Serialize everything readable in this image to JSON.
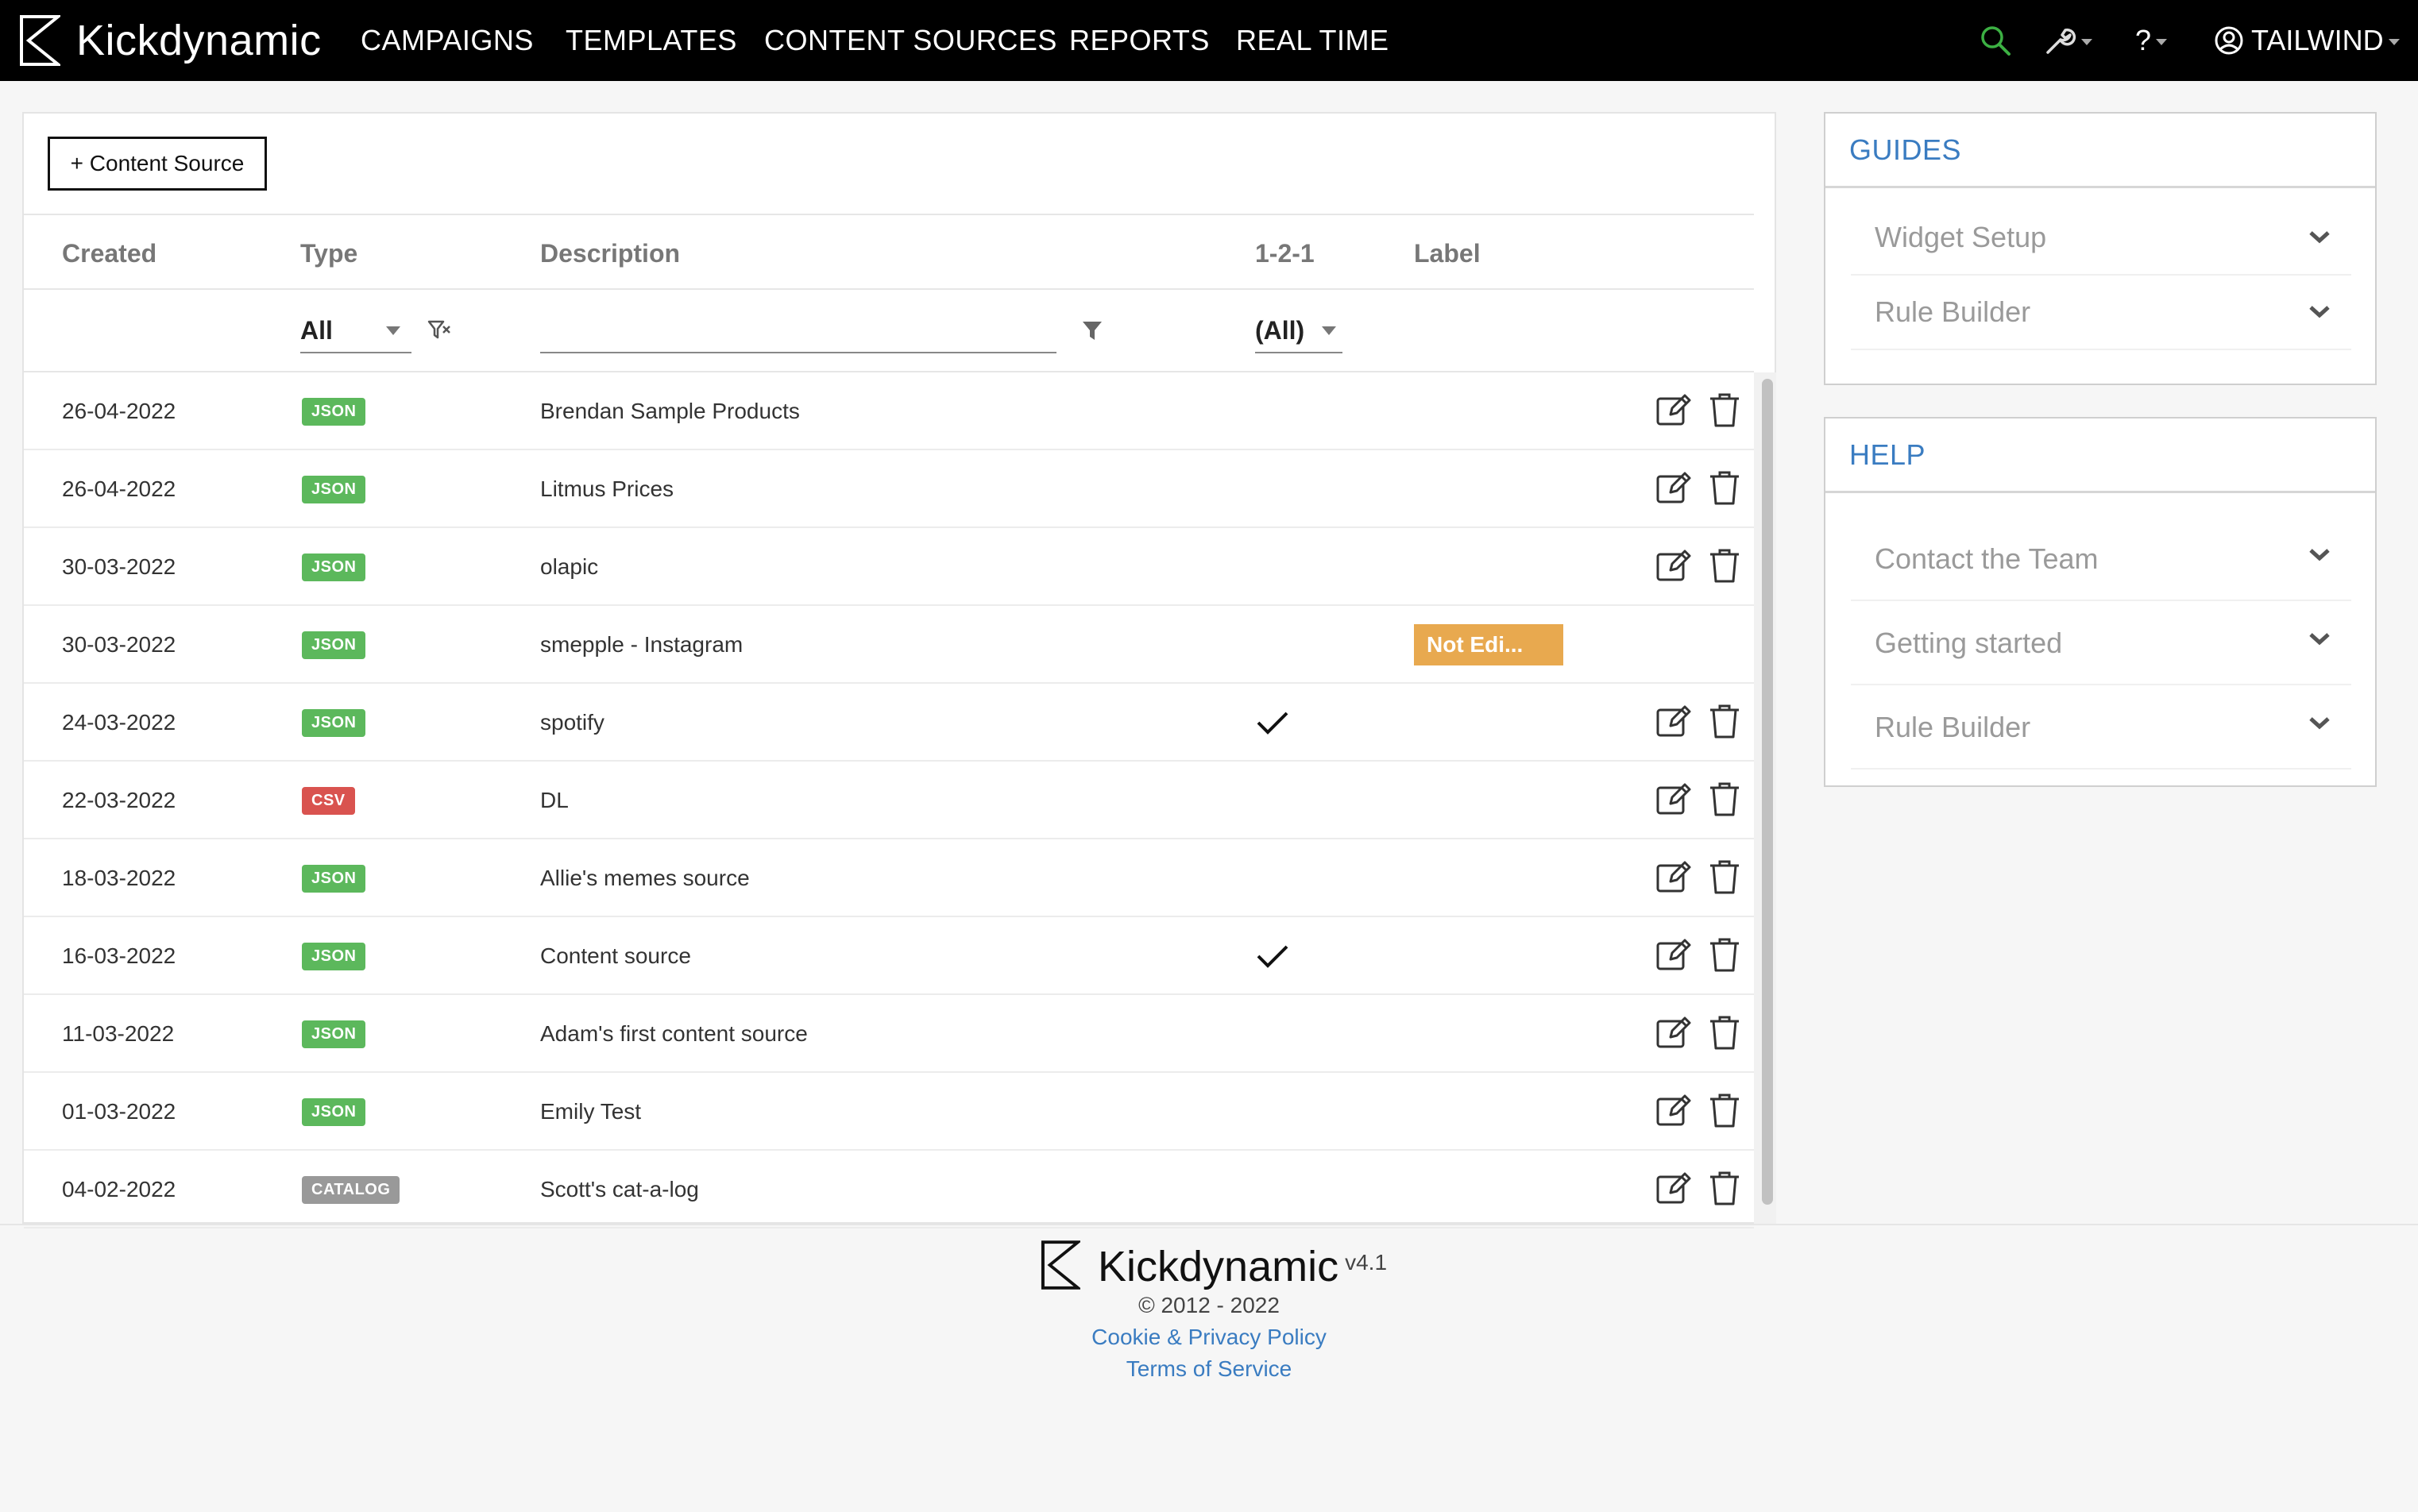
{
  "brand": {
    "name": "Kickdynamic"
  },
  "nav": {
    "links": [
      "CAMPAIGNS",
      "TEMPLATES",
      "CONTENT SOURCES",
      "REPORTS",
      "REAL TIME"
    ],
    "help_label": "?",
    "user_label": "TAILWIND",
    "search_icon": "search-icon",
    "tools_icon": "wrench-icon",
    "accent_color": "#3cb043"
  },
  "main": {
    "add_button_label": "+ Content Source",
    "columns": {
      "created": "Created",
      "type": "Type",
      "description": "Description",
      "one_two_one": "1-2-1",
      "label": "Label"
    },
    "filters": {
      "type_value": "All",
      "description_value": "",
      "one_two_one_value": "(All)"
    },
    "rows": [
      {
        "created": "26-04-2022",
        "type": "JSON",
        "description": "Brendan Sample Products",
        "one_two_one": false,
        "label": "",
        "actions": true
      },
      {
        "created": "26-04-2022",
        "type": "JSON",
        "description": "Litmus Prices",
        "one_two_one": false,
        "label": "",
        "actions": true
      },
      {
        "created": "30-03-2022",
        "type": "JSON",
        "description": "olapic",
        "one_two_one": false,
        "label": "",
        "actions": true
      },
      {
        "created": "30-03-2022",
        "type": "JSON",
        "description": "smepple - Instagram",
        "one_two_one": false,
        "label": "Not Edi...",
        "actions": false
      },
      {
        "created": "24-03-2022",
        "type": "JSON",
        "description": "spotify",
        "one_two_one": true,
        "label": "",
        "actions": true
      },
      {
        "created": "22-03-2022",
        "type": "CSV",
        "description": "DL",
        "one_two_one": false,
        "label": "",
        "actions": true
      },
      {
        "created": "18-03-2022",
        "type": "JSON",
        "description": "Allie's memes source",
        "one_two_one": false,
        "label": "",
        "actions": true
      },
      {
        "created": "16-03-2022",
        "type": "JSON",
        "description": "Content source",
        "one_two_one": true,
        "label": "",
        "actions": true
      },
      {
        "created": "11-03-2022",
        "type": "JSON",
        "description": "Adam's first content source",
        "one_two_one": false,
        "label": "",
        "actions": true
      },
      {
        "created": "01-03-2022",
        "type": "JSON",
        "description": "Emily Test",
        "one_two_one": false,
        "label": "",
        "actions": true
      },
      {
        "created": "04-02-2022",
        "type": "CATALOG",
        "description": "Scott's cat-a-log",
        "one_two_one": false,
        "label": "",
        "actions": true
      }
    ],
    "badge_colors": {
      "JSON": "#5cb85c",
      "CSV": "#d9534f",
      "CATALOG": "#999999"
    }
  },
  "guides": {
    "title": "GUIDES",
    "items": [
      "Widget Setup",
      "Rule Builder"
    ]
  },
  "help": {
    "title": "HELP",
    "items": [
      "Contact the Team",
      "Getting started",
      "Rule Builder"
    ]
  },
  "footer": {
    "brand": "Kickdynamic",
    "version": "v4.1",
    "copyright": "© 2012 - 2022",
    "privacy_link": "Cookie & Privacy Policy",
    "terms_link": "Terms of Service"
  }
}
